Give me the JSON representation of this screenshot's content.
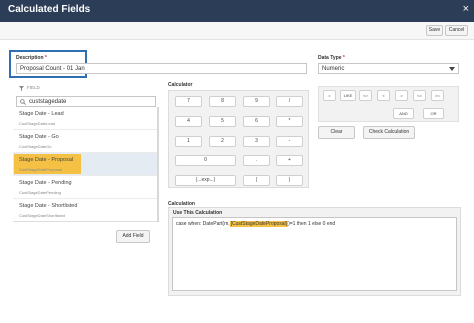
{
  "window": {
    "title": "Calculated Fields",
    "close_glyph": "×"
  },
  "toolbar": {
    "save_label": "Save",
    "cancel_label": "Cancel"
  },
  "description": {
    "label": "Description",
    "required_mark": "*",
    "value": "Proposal Count - 01 Jan"
  },
  "data_type": {
    "label": "Data Type",
    "required_mark": "*",
    "value": "Numeric"
  },
  "field_panel": {
    "header": "FIELD",
    "search_value": "custstagedate",
    "add_field_label": "Add Field",
    "items": [
      {
        "name": "Stage Date - Lead",
        "key": "CustStageDateLead",
        "selected": false
      },
      {
        "name": "Stage Date - Go",
        "key": "CustStageDateGo",
        "selected": false
      },
      {
        "name": "Stage Date - Proposal",
        "key": "CustStageDateProposal",
        "selected": true
      },
      {
        "name": "Stage Date - Pending",
        "key": "CustStageDatePending",
        "selected": false
      },
      {
        "name": "Stage Date - Shortlisted",
        "key": "CustStageDateShortlisted",
        "selected": false
      }
    ]
  },
  "calculator": {
    "label": "Calculator",
    "keys": {
      "k7": "7",
      "k8": "8",
      "k9": "9",
      "div": "/",
      "k4": "4",
      "k5": "5",
      "k6": "6",
      "mul": "*",
      "k1": "1",
      "k2": "2",
      "k3": "3",
      "minus": "-",
      "k0": "0",
      "dot": ".",
      "plus": "+",
      "expr": "(...exp...)",
      "lparen": "(",
      "rparen": ")"
    }
  },
  "operators": {
    "eq": "=",
    "like": "LIKE",
    "ne": "<>",
    "lt": "<",
    "gt": ">",
    "le": "<=",
    "ge": ">=",
    "and": "AND",
    "or": "OR",
    "clear_label": "Clear",
    "check_label": "Check Calculation"
  },
  "calculation": {
    "label": "Calculation",
    "use_label": "Use This Calculation",
    "formula_pre": "case when: DatePart(m,",
    "formula_highlight": "[CustStageDateProposal]",
    "formula_post": ")=1 then 1 else 0 end"
  }
}
